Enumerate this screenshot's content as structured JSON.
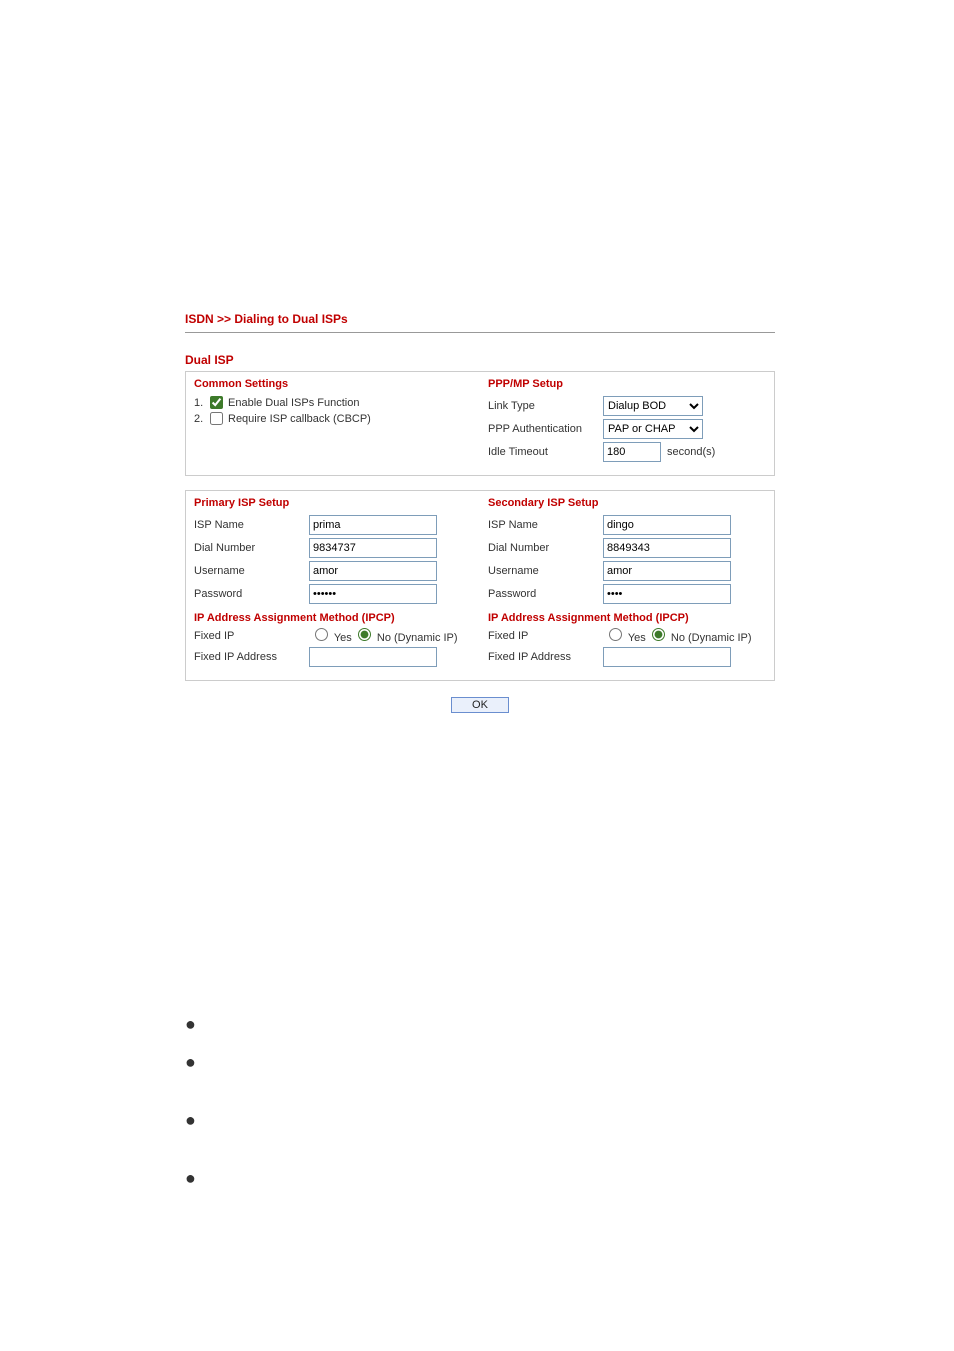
{
  "breadcrumb": "ISDN >> Dialing to Dual ISPs",
  "dual_isp_title": "Dual ISP",
  "common": {
    "header": "Common Settings",
    "item1_num": "1.",
    "item1_label": "Enable Dual ISPs Function",
    "item1_checked": true,
    "item2_num": "2.",
    "item2_label": "Require ISP callback (CBCP)",
    "item2_checked": false
  },
  "pppmp": {
    "header": "PPP/MP Setup",
    "link_type_label": "Link Type",
    "link_type_value": "Dialup BOD",
    "ppp_auth_label": "PPP Authentication",
    "ppp_auth_value": "PAP or CHAP",
    "idle_label": "Idle Timeout",
    "idle_value": "180",
    "idle_unit": "second(s)"
  },
  "primary": {
    "header": "Primary ISP Setup",
    "isp_name_label": "ISP Name",
    "isp_name_value": "prima",
    "dial_label": "Dial Number",
    "dial_value": "9834737",
    "user_label": "Username",
    "user_value": "amor",
    "pass_label": "Password",
    "pass_value": "••••••",
    "ipcp_header": "IP Address Assignment Method (IPCP)",
    "fixed_ip_label": "Fixed IP",
    "yes_label": "Yes",
    "no_label": "No (Dynamic IP)",
    "fixed_ip_addr_label": "Fixed IP Address",
    "fixed_ip_addr_value": ""
  },
  "secondary": {
    "header": "Secondary ISP Setup",
    "isp_name_label": "ISP Name",
    "isp_name_value": "dingo",
    "dial_label": "Dial Number",
    "dial_value": "8849343",
    "user_label": "Username",
    "user_value": "amor",
    "pass_label": "Password",
    "pass_value": "••••",
    "ipcp_header": "IP Address Assignment Method (IPCP)",
    "fixed_ip_label": "Fixed IP",
    "yes_label": "Yes",
    "no_label": "No (Dynamic IP)",
    "fixed_ip_addr_label": "Fixed IP Address",
    "fixed_ip_addr_value": ""
  },
  "ok_button": "OK",
  "bullet": "●"
}
